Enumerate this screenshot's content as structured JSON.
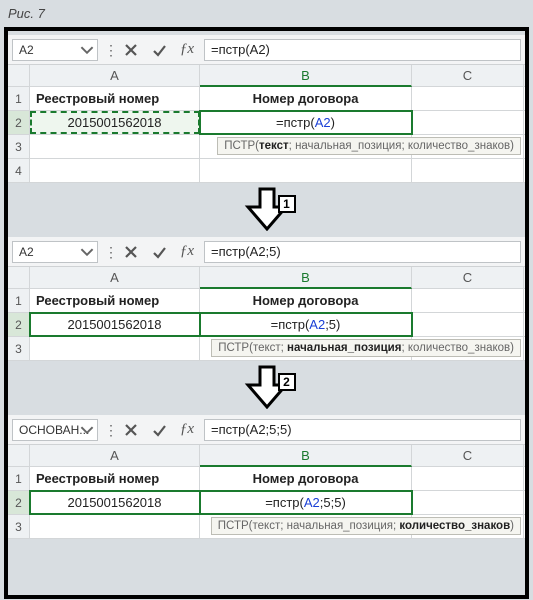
{
  "figure_label": "Рис. 7",
  "columns": {
    "A": "A",
    "B": "B",
    "C": "C"
  },
  "rows": [
    "1",
    "2",
    "3",
    "4"
  ],
  "header_row": {
    "col_a": "Реестровый номер",
    "col_b": "Номер договора"
  },
  "value_a2": "2015001562018",
  "steps": [
    {
      "namebox": "A2",
      "formula": "=пстр(A2)",
      "cell_b2_prefix": "=пстр(",
      "cell_b2_ref": "A2",
      "cell_b2_suffix": ")",
      "tooltip_fn": "ПСТР",
      "tooltip_p1": "текст",
      "tooltip_p2": "начальная_позиция",
      "tooltip_p3": "количество_знаков",
      "tooltip_bold_index": 1,
      "arrow_label": "1"
    },
    {
      "namebox": "A2",
      "formula": "=пстр(A2;5)",
      "cell_b2_prefix": "=пстр(",
      "cell_b2_ref": "A2",
      "cell_b2_suffix": ";5)",
      "tooltip_fn": "ПСТР",
      "tooltip_p1": "текст",
      "tooltip_p2": "начальная_позиция",
      "tooltip_p3": "количество_знаков",
      "tooltip_bold_index": 2,
      "arrow_label": "2"
    },
    {
      "namebox": "ОСНОВАН...",
      "formula": "=пстр(A2;5;5)",
      "cell_b2_prefix": "=пстр(",
      "cell_b2_ref": "A2",
      "cell_b2_suffix": ";5;5)",
      "tooltip_fn": "ПСТР",
      "tooltip_p1": "текст",
      "tooltip_p2": "начальная_позиция",
      "tooltip_p3": "количество_знаков",
      "tooltip_bold_index": 3,
      "arrow_label": null
    }
  ]
}
